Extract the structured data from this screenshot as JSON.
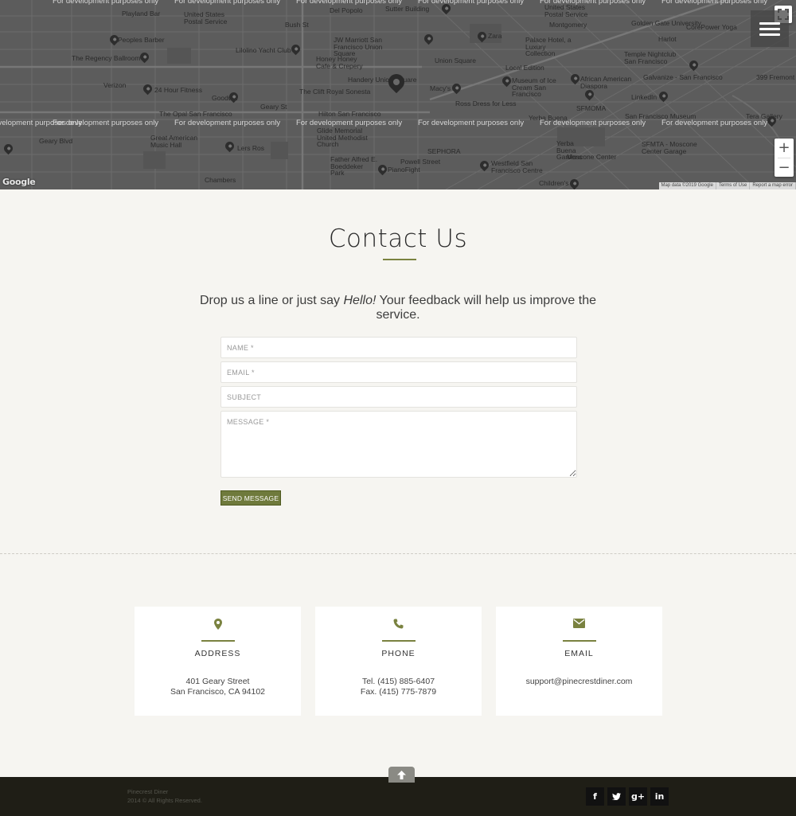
{
  "map": {
    "dev_watermark": "For development purposes only",
    "labels": [
      "Playland Bar",
      "United States Postal Service",
      "Bush St",
      "Sutter Building",
      "Del Popolo",
      "United States Postal Service",
      "Peoples Barber",
      "Lilolino Yacht Club",
      "JW Marriott San Francisco Union Square",
      "Zara",
      "Golden Gate University",
      "CorePower Yoga",
      "The Regency Ballroom",
      "Honey Honey Cafe & Crepery",
      "Union Square",
      "Palace Hotel, a Luxury Collection",
      "Harlot",
      "Temple Nightclub San Francisco",
      "Verizon",
      "24 Hour Fitness",
      "Handery Union Square",
      "Macy's",
      "Local Edition",
      "Museum of Ice Cream San Francisco",
      "African American Diaspora",
      "Galvanize - San Francisco",
      "399 Fremont",
      "Goodwill",
      "The Clift Royal Sonesta",
      "Ross Dress for Less",
      "LinkedIn",
      "The Opal San Francisco",
      "Hilton San Francisco",
      "Yerba Buena",
      "SFMOMA",
      "San Francisco Museum",
      "Tera Gallery",
      "Great American Music Hall",
      "Glide Memorial United Methodist Church",
      "SFMTA - Moscone Center Garage",
      "Geary Blvd",
      "Lers Ros",
      "SEPHORA",
      "Yerba Buena Gardens",
      "Moscone Center",
      "Father Alfred E. Boeddeker Park",
      "PianoFight",
      "Powell Street",
      "Westfield San Francisco Centre",
      "Chambers",
      "Children's",
      "Montgomery",
      "Geary St"
    ],
    "attribution": [
      "Map data ©2019 Google",
      "Terms of Use",
      "Report a map error"
    ],
    "google_logo": "Google",
    "zoom_in": "+",
    "zoom_out": "−"
  },
  "contact": {
    "title": "Contact Us",
    "intro_pre": "Drop us a line or just say ",
    "intro_em": "Hello!",
    "intro_post": "  Your feedback will help us improve the service.",
    "form": {
      "name_placeholder": "NAME *",
      "email_placeholder": "EMAIL *",
      "subject_placeholder": "SUBJECT",
      "message_placeholder": "MESSAGE *",
      "submit_label": "SEND MESSAGE"
    }
  },
  "info": {
    "address": {
      "icon": "map-marker-icon",
      "title": "ADDRESS",
      "line1": "401 Geary Street",
      "line2": "San Francisco, CA 94102"
    },
    "phone": {
      "icon": "phone-icon",
      "title": "PHONE",
      "line1": "Tel. (415) 885-6407",
      "line2": "Fax. (415) 775-7879"
    },
    "email": {
      "icon": "envelope-icon",
      "title": "EMAIL",
      "line1": "support@pinecrestdiner.com"
    }
  },
  "footer": {
    "name": "Pinecrest Diner",
    "copyright": "2014 © All Rights Reserved.",
    "social": [
      {
        "icon": "facebook-icon",
        "glyph": "f"
      },
      {
        "icon": "twitter-icon",
        "glyph": "t"
      },
      {
        "icon": "google-plus-icon",
        "glyph": "g+"
      },
      {
        "icon": "linkedin-icon",
        "glyph": "in"
      }
    ]
  },
  "colors": {
    "accent": "#6f7a3c",
    "background": "#f6f5f1",
    "footer": "#1f1e16",
    "map": "#5b5b5b"
  }
}
